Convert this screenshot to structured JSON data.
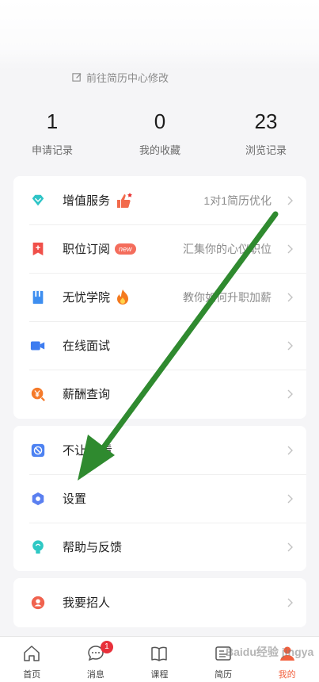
{
  "profile": {
    "edit_hint": "前往简历中心修改"
  },
  "stats": [
    {
      "value": "1",
      "label": "申请记录"
    },
    {
      "value": "0",
      "label": "我的收藏"
    },
    {
      "value": "23",
      "label": "浏览记录"
    }
  ],
  "menu1": [
    {
      "label": "增值服务",
      "icon": "diamond-icon",
      "right": "1对1简历优化"
    },
    {
      "label": "职位订阅",
      "icon": "bookmark-icon",
      "badge": "new",
      "right": "汇集你的心仪职位"
    },
    {
      "label": "无忧学院",
      "icon": "book-icon",
      "right": "教你如何升职加薪"
    },
    {
      "label": "在线面试",
      "icon": "video-camera-icon"
    },
    {
      "label": "薪酬查询",
      "icon": "yuan-search-icon"
    }
  ],
  "menu2": [
    {
      "label": "不让TA看",
      "icon": "block-icon"
    },
    {
      "label": "设置",
      "icon": "settings-icon"
    },
    {
      "label": "帮助与反馈",
      "icon": "help-bulb-icon"
    }
  ],
  "menu3": [
    {
      "label": "我要招人",
      "icon": "recruit-icon"
    }
  ],
  "nav": [
    {
      "label": "首页",
      "icon": "home-icon"
    },
    {
      "label": "消息",
      "icon": "chat-icon",
      "badge": "1"
    },
    {
      "label": "课程",
      "icon": "open-book-icon"
    },
    {
      "label": "简历",
      "icon": "resume-icon"
    },
    {
      "label": "我的",
      "icon": "user-icon",
      "active": true
    }
  ],
  "colors": {
    "accent": "#f2603e",
    "annotation_arrow": "#2f8a2f",
    "badge": "#e8303a"
  },
  "watermark": "Baidu经验 jingyan.baidu.com"
}
